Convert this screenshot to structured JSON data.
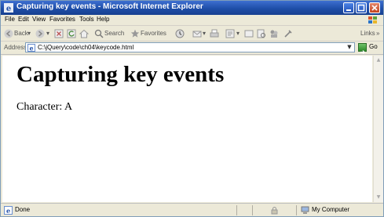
{
  "window": {
    "title": "Capturing key events - Microsoft Internet Explorer"
  },
  "menu": [
    "File",
    "Edit",
    "View",
    "Favorites",
    "Tools",
    "Help"
  ],
  "toolbar": {
    "back_label": "Back",
    "search_label": "Search",
    "favorites_label": "Favorites",
    "links_label": "Links"
  },
  "address": {
    "label": "Address",
    "url": "C:\\jQuery\\code\\ch04\\keycode.html",
    "go_label": "Go"
  },
  "page": {
    "heading": "Capturing key events",
    "character_line": "Character: A"
  },
  "status": {
    "text": "Done",
    "zone": "My Computer"
  },
  "colors": {
    "titlebar": "#1f4ea8",
    "chrome": "#ece9d8",
    "content_bg": "#ffffff"
  }
}
